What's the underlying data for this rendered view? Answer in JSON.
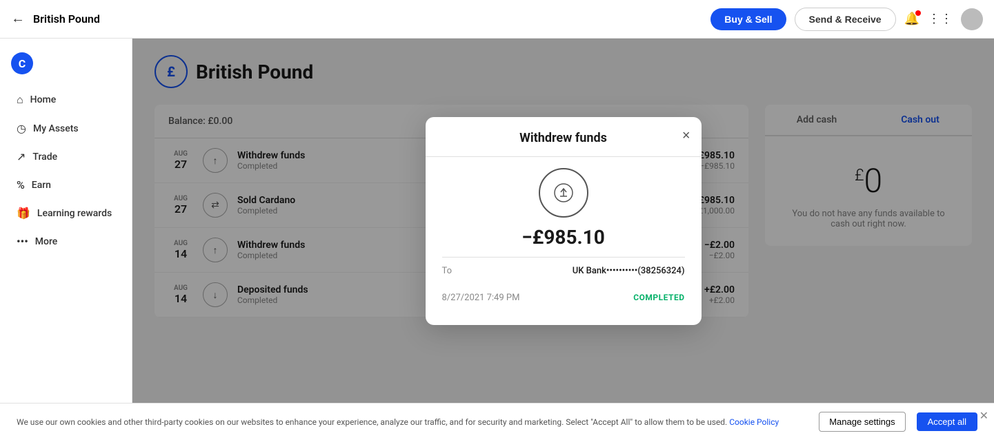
{
  "topnav": {
    "back_icon": "←",
    "title": "British Pound",
    "buy_sell_label": "Buy & Sell",
    "send_receive_label": "Send & Receive"
  },
  "sidebar": {
    "logo_text": "C",
    "items": [
      {
        "id": "home",
        "label": "Home",
        "icon": "⌂"
      },
      {
        "id": "my-assets",
        "label": "My Assets",
        "icon": "◷"
      },
      {
        "id": "trade",
        "label": "Trade",
        "icon": "↗"
      },
      {
        "id": "earn",
        "label": "Earn",
        "icon": "%"
      },
      {
        "id": "learning-rewards",
        "label": "Learning rewards",
        "icon": "🎁"
      },
      {
        "id": "more",
        "label": "More",
        "icon": "…"
      }
    ]
  },
  "page": {
    "currency_symbol": "£",
    "title": "British Pound",
    "balance_label": "Balance: £0.00"
  },
  "transactions": [
    {
      "month": "AUG",
      "day": "27",
      "icon": "↑",
      "name": "Withdrew funds",
      "status": "Completed",
      "amount_main": "−£985.10",
      "amount_sub": "−£985.10"
    },
    {
      "month": "AUG",
      "day": "27",
      "icon": "⇄",
      "name": "Sold Cardano",
      "status": "Completed",
      "amount_main": "+£985.10",
      "amount_sub": "−£1,000.00"
    },
    {
      "month": "AUG",
      "day": "14",
      "icon": "↑",
      "name": "Withdrew funds",
      "status": "Completed",
      "amount_main": "−£2.00",
      "amount_sub": "−£2.00"
    },
    {
      "month": "AUG",
      "day": "14",
      "icon": "↓",
      "name": "Deposited funds",
      "status": "Completed",
      "amount_main": "+£2.00",
      "amount_sub": "+£2.00"
    }
  ],
  "right_panel": {
    "tab_add_cash": "Add cash",
    "tab_cash_out": "Cash out",
    "amount_superscript": "£",
    "amount": "0",
    "note": "You do not have any funds available to cash out right now."
  },
  "modal": {
    "title": "Withdrew funds",
    "close_icon": "×",
    "upload_icon": "↑",
    "amount": "−£985.10",
    "to_label": "To",
    "to_value": "UK Bank••••••••••(38256324)",
    "date_value": "8/27/2021 7:49 PM",
    "status": "COMPLETED"
  },
  "cookie": {
    "text": "We use our own cookies and other third-party cookies on our websites to enhance your experience, analyze our traffic, and for security and marketing. Select \"Accept All\" to allow them to be used.",
    "link_text": "Cookie Policy",
    "manage_label": "Manage settings",
    "accept_label": "Accept all"
  }
}
